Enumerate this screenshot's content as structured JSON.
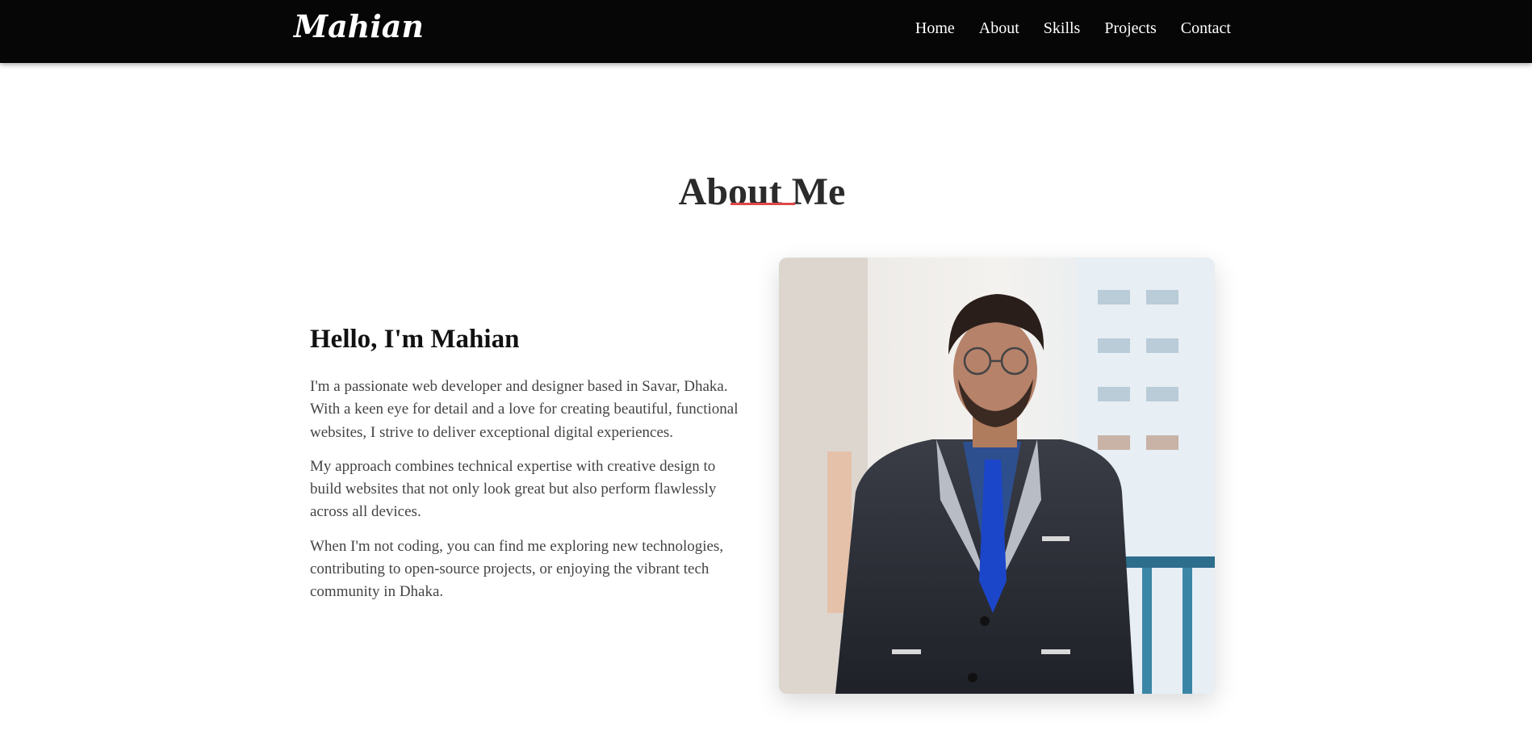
{
  "nav": {
    "logo": "Mahian",
    "links": [
      "Home",
      "About",
      "Skills",
      "Projects",
      "Contact"
    ]
  },
  "about": {
    "title": "About Me",
    "heading": "Hello, I'm Mahian",
    "paragraphs": [
      "I'm a passionate web developer and designer based in Savar, Dhaka. With a keen eye for detail and a love for creating beautiful, functional websites, I strive to deliver exceptional digital experiences.",
      "My approach combines technical expertise with creative design to build websites that not only look great but also perform flawlessly across all devices.",
      "When I'm not coding, you can find me exploring new technologies, contributing to open-source projects, or enjoying the vibrant tech community in Dhaka."
    ]
  },
  "colors": {
    "navbar": "#060606",
    "accent": "#e04848",
    "title": "#2b2b2b",
    "body_text": "#444444"
  }
}
